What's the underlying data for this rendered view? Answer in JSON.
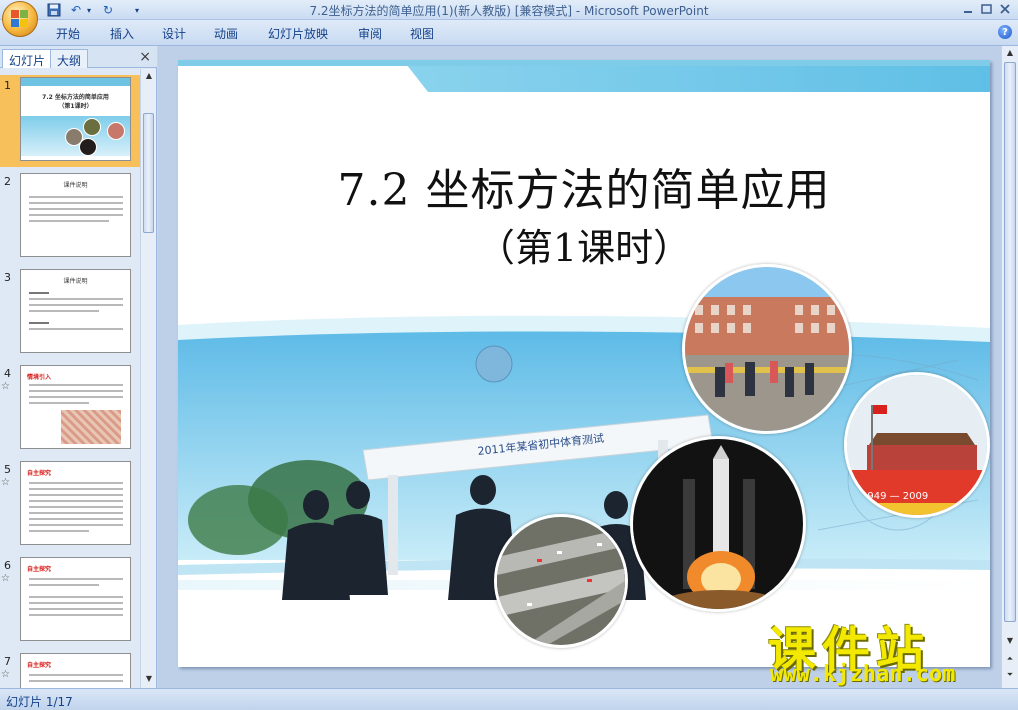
{
  "window": {
    "title": "7.2坐标方法的简单应用(1)(新人教版) [兼容模式]",
    "title_sep": " - ",
    "app_name": "Microsoft PowerPoint"
  },
  "ribbon": {
    "tabs": [
      "开始",
      "插入",
      "设计",
      "动画",
      "幻灯片放映",
      "审阅",
      "视图"
    ],
    "help_label": "?"
  },
  "pane": {
    "tabs": [
      "幻灯片",
      "大纲"
    ],
    "close_label": "×"
  },
  "thumbnails": [
    {
      "num": "1",
      "title": "7.2 坐标方法的简单应用\n（第1课时）"
    },
    {
      "num": "2",
      "title": "课件说明"
    },
    {
      "num": "3",
      "title": "课件说明"
    },
    {
      "num": "4",
      "title": "情境引入"
    },
    {
      "num": "5",
      "title": "自主探究"
    },
    {
      "num": "6",
      "title": "自主探究"
    },
    {
      "num": "7",
      "title": "自主探究"
    }
  ],
  "slide": {
    "title": "7.2 坐标方法的简单应用",
    "subtitle": "（第1课时）",
    "photo_caption": "2011年某省初中体育测试"
  },
  "status": {
    "slide_indicator": "幻灯片 1/17"
  },
  "watermark": {
    "cn": "课件站",
    "url": "www.kjzhan.com"
  }
}
